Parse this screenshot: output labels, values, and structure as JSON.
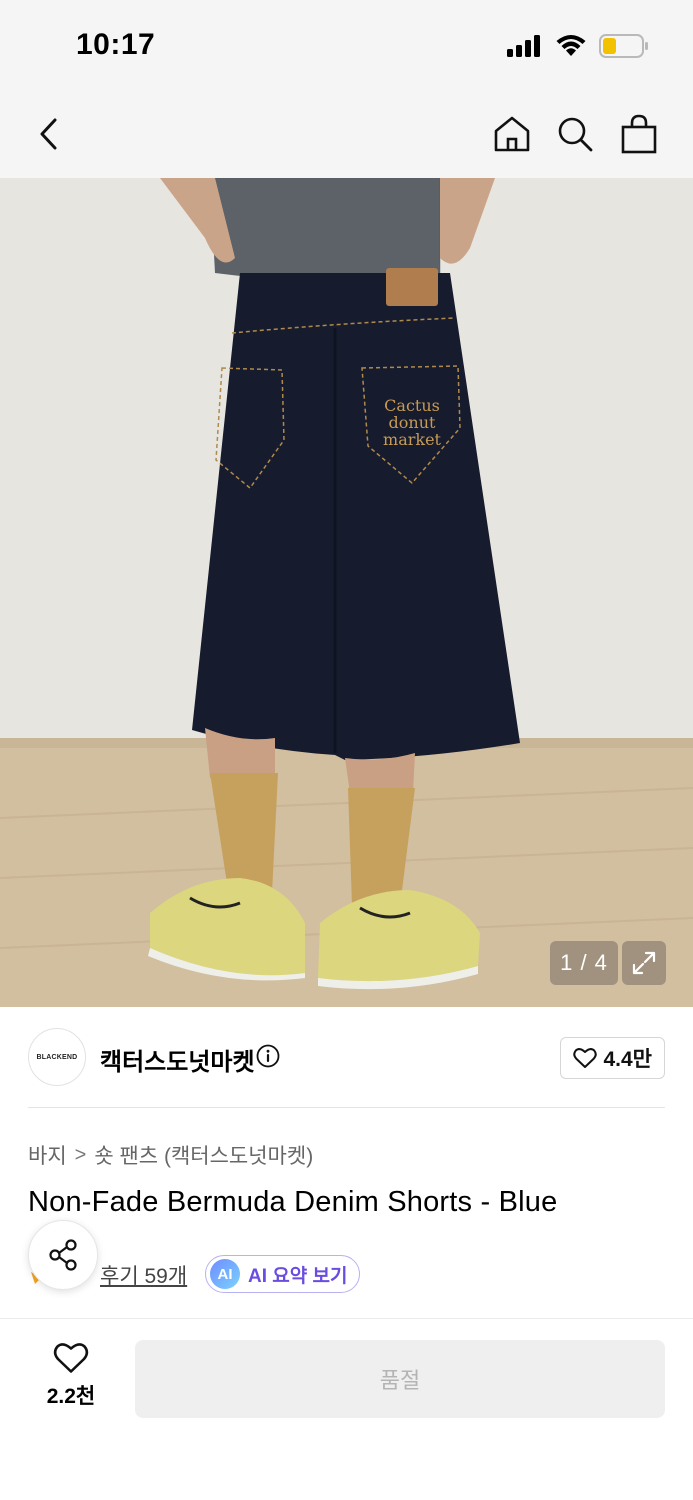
{
  "status_bar": {
    "time": "10:17",
    "battery_color": "#f2c200"
  },
  "nav": {
    "icons": [
      "back-icon",
      "home-icon",
      "search-icon",
      "bag-icon"
    ]
  },
  "gallery": {
    "counter": "1 / 4",
    "pocket_embroidery": "Cactus\ndonut\nmarket"
  },
  "brand": {
    "logo_text": "BLACKEND",
    "name": "캑터스도넛마켓",
    "likes": "4.4만"
  },
  "breadcrumb": {
    "category": "바지",
    "separator": ">",
    "subcategory": "숏 팬츠 (캑터스도넛마켓)"
  },
  "product": {
    "title": "Non-Fade Bermuda Denim Shorts - Blue"
  },
  "review": {
    "link": "후기 59개",
    "ai_badge": "AI",
    "ai_label": "AI 요약 보기"
  },
  "bottom_bar": {
    "wish_count": "2.2천",
    "purchase_label": "품절"
  },
  "colors": {
    "accent_purple": "#6a4ce0",
    "star_orange": "#f5a623"
  }
}
